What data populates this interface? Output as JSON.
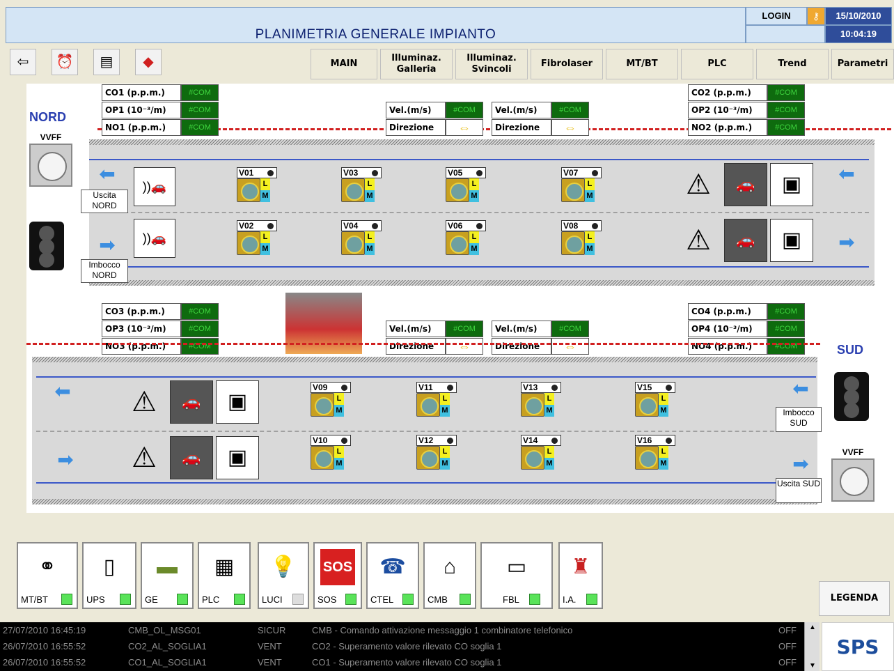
{
  "header": {
    "title": "PLANIMETRIA GENERALE IMPIANTO",
    "login": "LOGIN",
    "date": "15/10/2010",
    "time": "10:04:19"
  },
  "toolbar": {
    "icons": [
      "back-icon",
      "alarm-clock-icon",
      "report-icon",
      "warning-icon"
    ]
  },
  "menu": [
    {
      "label": "MAIN"
    },
    {
      "label": "Illuminaz. Galleria"
    },
    {
      "label": "Illuminaz. Svincoli"
    },
    {
      "label": "Fibrolaser"
    },
    {
      "label": "MT/BT"
    },
    {
      "label": "PLC"
    },
    {
      "label": "Trend"
    },
    {
      "label": "Parametri"
    }
  ],
  "labels": {
    "nord": "NORD",
    "sud": "SUD",
    "vvff": "VVFF",
    "uscita_nord": "Uscita NORD",
    "imbocco_nord": "Imbocco NORD",
    "imbocco_sud": "Imbocco SUD",
    "uscita_sud": "Uscita SUD"
  },
  "com": "#COM",
  "sensors": {
    "n_left": [
      "CO1 (p.p.m.)",
      "OP1 (10⁻³/m)",
      "NO1 (p.p.m.)"
    ],
    "n_right": [
      "CO2 (p.p.m.)",
      "OP2 (10⁻³/m)",
      "NO2 (p.p.m.)"
    ],
    "s_left": [
      "CO3 (p.p.m.)",
      "OP3 (10⁻³/m)",
      "NO3 (p.p.m.)"
    ],
    "s_right": [
      "CO4 (p.p.m.)",
      "OP4 (10⁻³/m)",
      "NO4 (p.p.m.)"
    ],
    "vel": "Vel.(m/s)",
    "dir": "Direzione"
  },
  "fans": {
    "north_top": [
      "V01",
      "V03",
      "V05",
      "V07"
    ],
    "north_bot": [
      "V02",
      "V04",
      "V06",
      "V08"
    ],
    "south_top": [
      "V09",
      "V11",
      "V13",
      "V15"
    ],
    "south_bot": [
      "V10",
      "V12",
      "V14",
      "V16"
    ],
    "L": "L",
    "M": "M"
  },
  "devices": [
    {
      "label": "MT/BT"
    },
    {
      "label": "UPS"
    },
    {
      "label": "GE"
    },
    {
      "label": "PLC"
    },
    {
      "label": "LUCI"
    },
    {
      "label": "SOS",
      "badge": "SOS"
    },
    {
      "label": "CTEL"
    },
    {
      "label": "CMB"
    },
    {
      "label": "FBL"
    },
    {
      "label": "I.A."
    }
  ],
  "legenda": "LEGENDA",
  "log": [
    {
      "ts": "27/07/2010  16:45:19",
      "code": "CMB_OL_MSG01",
      "grp": "SICUR",
      "msg": "CMB - Comando attivazione messaggio 1 combinatore telefonico",
      "st": "OFF"
    },
    {
      "ts": "26/07/2010  16:55:52",
      "code": "CO2_AL_SOGLIA1",
      "grp": "VENT",
      "msg": "CO2 - Superamento valore rilevato CO soglia 1",
      "st": "OFF"
    },
    {
      "ts": "26/07/2010  16:55:52",
      "code": "CO1_AL_SOGLIA1",
      "grp": "VENT",
      "msg": "CO1 - Superamento valore rilevato CO soglia 1",
      "st": "OFF"
    }
  ],
  "logo": "SPS"
}
